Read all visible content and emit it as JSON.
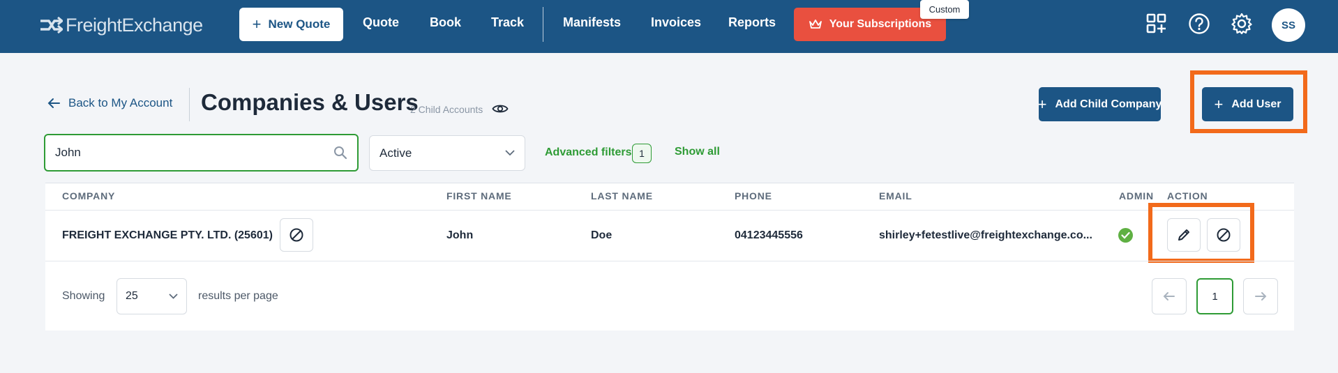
{
  "nav": {
    "logo": "FreightExchange",
    "new_quote": "New Quote",
    "links": [
      "Quote",
      "Book",
      "Track",
      "Manifests",
      "Invoices",
      "Reports"
    ],
    "subscriptions": "Your Subscriptions",
    "custom_badge": "Custom",
    "avatar_initials": "SS",
    "icons": [
      "apps-add-icon",
      "help-icon",
      "gear-icon"
    ]
  },
  "header": {
    "back": "Back to My Account",
    "title": "Companies & Users",
    "child_accounts": "2 Child Accounts",
    "add_child_company": "Add Child Company",
    "add_user": "Add User"
  },
  "filters": {
    "search_value": "John",
    "status": "Active",
    "advanced_filters": "Advanced filters",
    "advanced_count": "1",
    "show_all": "Show all"
  },
  "table": {
    "columns": [
      "COMPANY",
      "FIRST NAME",
      "LAST NAME",
      "PHONE",
      "EMAIL",
      "ADMIN",
      "ACTION"
    ],
    "rows": [
      {
        "company": "FREIGHT EXCHANGE PTY. LTD. (25601)",
        "first_name": "John",
        "last_name": "Doe",
        "phone": "04123445556",
        "email": "shirley+fetestlive@freightexchange.co...",
        "admin": true
      }
    ]
  },
  "pagination": {
    "showing": "Showing",
    "per_page": "25",
    "results_label": "results per page",
    "current_page": "1"
  },
  "colors": {
    "nav_bg": "#1c5585",
    "accent_green": "#2e9b35",
    "subscription_red": "#e9503f",
    "highlight_orange": "#f26a1b"
  }
}
